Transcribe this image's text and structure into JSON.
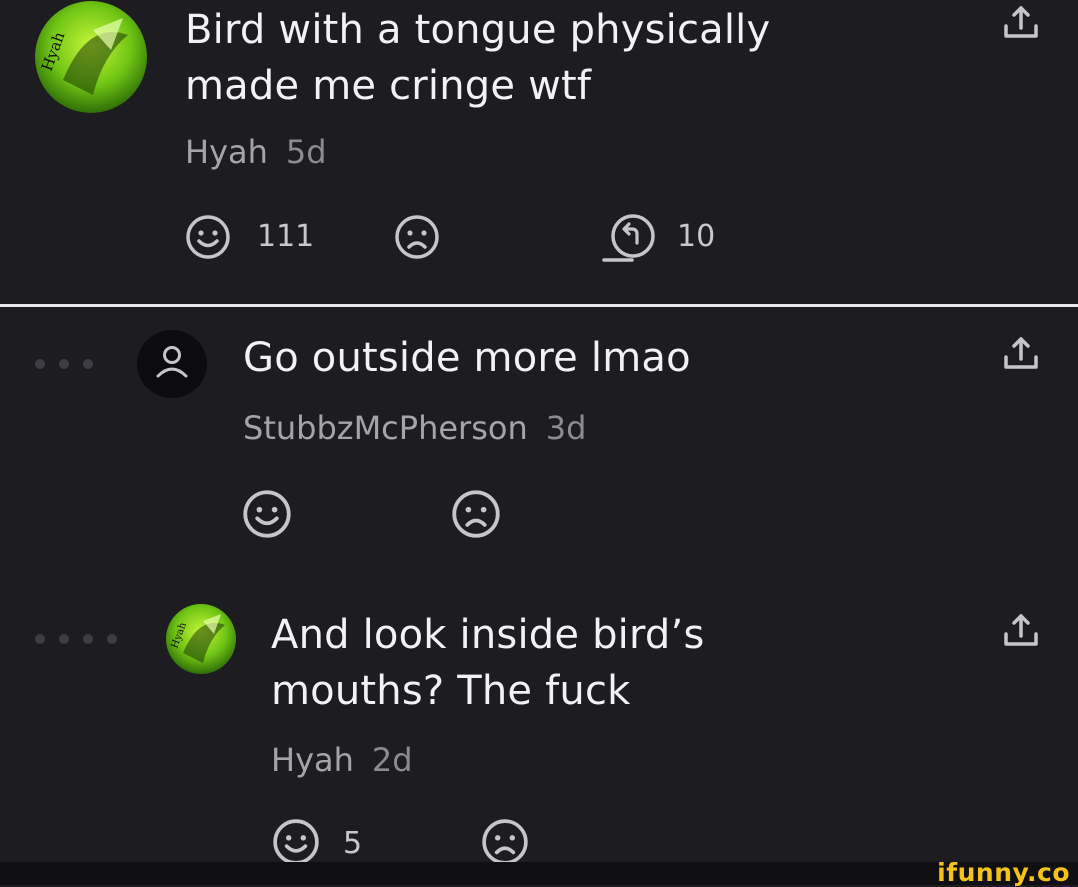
{
  "colors": {
    "background": "#1c1c21",
    "text": "#f2f2f2",
    "muted": "#a4a4a9",
    "divider": "#e9e9ee",
    "brand": "#f4c21a",
    "avatar_green": "#7fd11a"
  },
  "comments": [
    {
      "text_line1": "Bird with a tongue physically",
      "text_line2": "made me cringe wtf",
      "author": "Hyah",
      "time": "5d",
      "smile_count": "111",
      "reply_count": "10",
      "avatar": "green-character-avatar"
    },
    {
      "text_line1": "Go outside more lmao",
      "author": "StubbzMcPherson",
      "time": "3d",
      "avatar": "default-user-avatar"
    },
    {
      "text_line1": "And look inside bird’s",
      "text_line2": "mouths? The fuck",
      "author": "Hyah",
      "time": "2d",
      "smile_count": "5",
      "avatar": "green-character-avatar"
    }
  ],
  "watermark": "ifunny.co"
}
